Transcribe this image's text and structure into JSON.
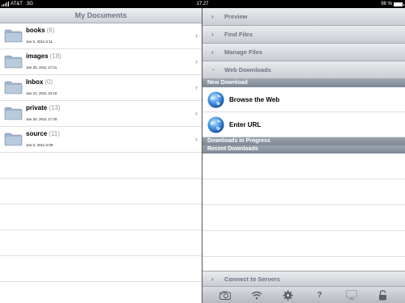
{
  "status_bar": {
    "carrier": "AT&T",
    "network": "3G",
    "time": "17:27",
    "battery_text": "98 %",
    "battery_level": 0.98
  },
  "left_pane": {
    "title": "My Documents",
    "items": [
      {
        "name": "books",
        "count": "(6)",
        "date": "Jan 5, 2011 6:11"
      },
      {
        "name": "images",
        "count": "(18)",
        "date": "Jan 30, 2011 17:21"
      },
      {
        "name": "Inbox",
        "count": "(0)",
        "date": "Jan 21, 2011 19:10"
      },
      {
        "name": "private",
        "count": "(13)",
        "date": "Jan 30, 2011 17:20"
      },
      {
        "name": "source",
        "count": "(11)",
        "date": "Jan 5, 2011 6:09"
      }
    ]
  },
  "right_pane": {
    "sections": [
      "Preview",
      "Find Files",
      "Manage Files",
      "Web Downloads"
    ],
    "new_download_label": "New Download",
    "actions": [
      "Browse the Web",
      "Enter URL"
    ],
    "downloads_in_progress_label": "Downloads in Progress",
    "recent_downloads_label": "Recent Downloads",
    "connect_label": "Connect to Servers"
  },
  "toolbar": {
    "items": [
      "camera-icon",
      "wifi-icon",
      "gear-icon",
      "help-icon",
      "monitor-icon",
      "lock-icon"
    ],
    "help_glyph": "?"
  }
}
